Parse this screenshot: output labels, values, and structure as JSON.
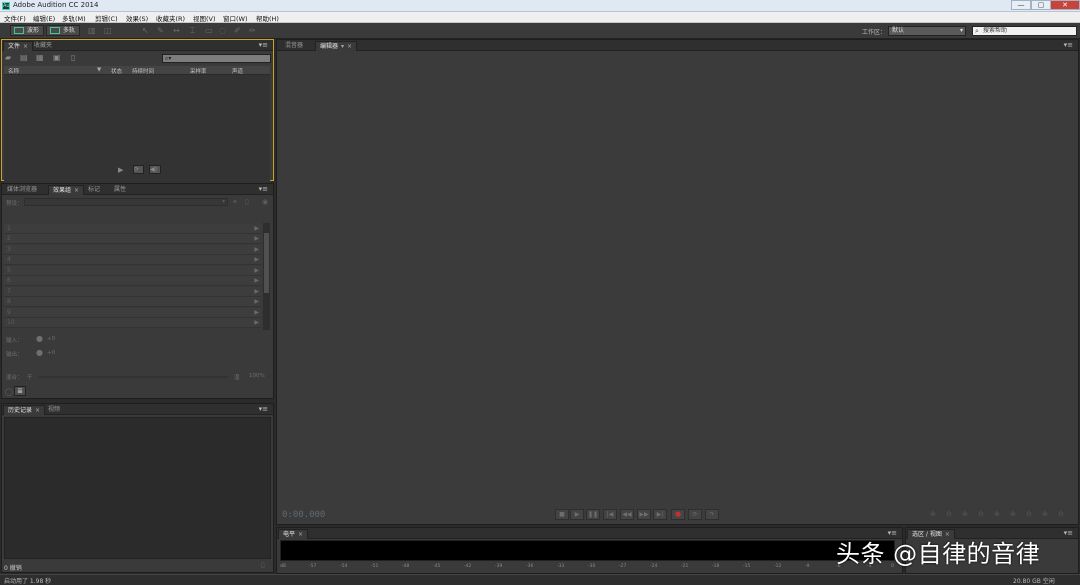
{
  "window": {
    "title": "Adobe Audition CC 2014",
    "app_icon": "Au",
    "controls": [
      "—",
      "▢",
      "✕"
    ]
  },
  "menu": [
    "文件(F)",
    "编辑(E)",
    "多轨(M)",
    "剪辑(C)",
    "效果(S)",
    "收藏夹(R)",
    "视图(V)",
    "窗口(W)",
    "帮助(H)"
  ],
  "toolbar": {
    "waveform_label": "波形",
    "multitrack_label": "多轨",
    "workspace_label": "工作区：",
    "workspace_value": "默认",
    "help_placeholder": "搜索帮助"
  },
  "files_panel": {
    "tabs": [
      "文件",
      "收藏夹"
    ],
    "columns": [
      "名称",
      "状态",
      "持续时间",
      "采样率",
      "声道"
    ]
  },
  "effects_panel": {
    "tabs": [
      "媒体浏览器",
      "效果组",
      "标记",
      "属性"
    ],
    "preset_label": "预设：",
    "rack_slots": [
      "1",
      "2",
      "3",
      "4",
      "5",
      "6",
      "7",
      "8",
      "9",
      "10"
    ],
    "input_label": "输入：",
    "input_value": "+0",
    "output_label": "输出：",
    "output_value": "+0",
    "mix_label": "混合：",
    "mix_dry": "干",
    "mix_wet": "湿",
    "mix_value": "100%"
  },
  "history_panel": {
    "tabs": [
      "历史记录",
      "视频"
    ],
    "undo_count": "0 撤销"
  },
  "editor_panel": {
    "tabs": [
      "混音器",
      "编辑器"
    ],
    "timecode": "0:00.000"
  },
  "level_panel": {
    "tab": "电平",
    "ticks": [
      "dB",
      "-57",
      "-54",
      "-51",
      "-48",
      "-45",
      "-42",
      "-39",
      "-36",
      "-33",
      "-30",
      "-27",
      "-24",
      "-21",
      "-18",
      "-15",
      "-12",
      "-9",
      "-6",
      "-3",
      "0"
    ]
  },
  "selection_panel": {
    "tab": "选区 / 视图"
  },
  "status": {
    "left": "启动用了 1.98 秒",
    "right": "20.80 GB 空闲"
  },
  "watermark": "头条 @自律的音律"
}
